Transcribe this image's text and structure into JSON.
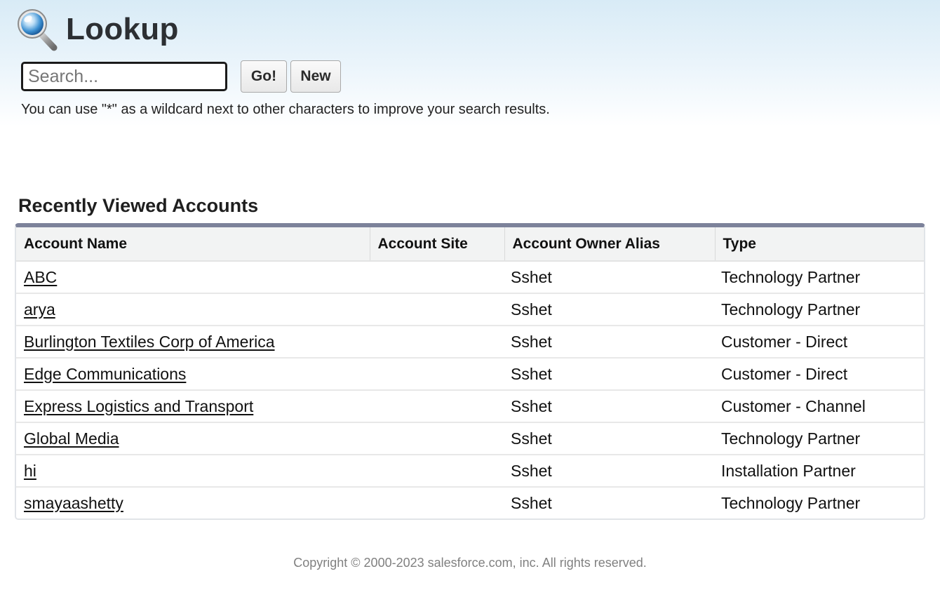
{
  "header": {
    "title": "Lookup",
    "icon": "magnifier-icon"
  },
  "search": {
    "value": "",
    "placeholder": "Search...",
    "go_label": "Go!",
    "new_label": "New",
    "hint": "You can use \"*\" as a wildcard next to other characters to improve your search results."
  },
  "recent": {
    "title": "Recently Viewed Accounts",
    "columns": [
      "Account Name",
      "Account Site",
      "Account Owner Alias",
      "Type"
    ],
    "rows": [
      {
        "name": "ABC",
        "site": "",
        "owner": "Sshet",
        "type": "Technology Partner"
      },
      {
        "name": "arya",
        "site": "",
        "owner": "Sshet",
        "type": "Technology Partner"
      },
      {
        "name": "Burlington Textiles Corp of America",
        "site": "",
        "owner": "Sshet",
        "type": "Customer - Direct"
      },
      {
        "name": "Edge Communications",
        "site": "",
        "owner": "Sshet",
        "type": "Customer - Direct"
      },
      {
        "name": "Express Logistics and Transport",
        "site": "",
        "owner": "Sshet",
        "type": "Customer - Channel"
      },
      {
        "name": "Global Media",
        "site": "",
        "owner": "Sshet",
        "type": "Technology Partner"
      },
      {
        "name": "hi",
        "site": "",
        "owner": "Sshet",
        "type": "Installation Partner"
      },
      {
        "name": "smayaashetty",
        "site": "",
        "owner": "Sshet",
        "type": "Technology Partner"
      }
    ]
  },
  "footer": {
    "copyright": "Copyright © 2000-2023 salesforce.com, inc. All rights reserved."
  },
  "colors": {
    "header_gradient_top": "#d8ebf6",
    "table_top_border": "#7c829a",
    "header_row_bg": "#f2f3f3",
    "footer_text": "#808080"
  }
}
